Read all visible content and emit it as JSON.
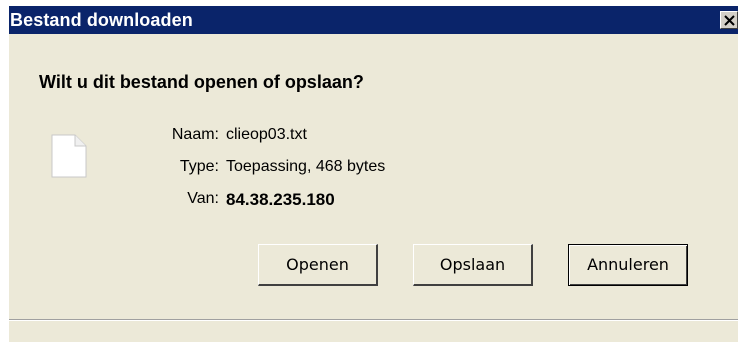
{
  "window": {
    "title": "Bestand downloaden"
  },
  "dialog": {
    "question": "Wilt u dit bestand openen of opslaan?",
    "file_icon": "text-file-icon",
    "rows": [
      {
        "label": "Naam:",
        "value": "clieop03.txt"
      },
      {
        "label": "Type:",
        "value": "Toepassing, 468 bytes"
      },
      {
        "label": "Van:",
        "value": "84.38.235.180"
      }
    ]
  },
  "buttons": {
    "open_label": "Openen",
    "save_label": "Opslaan",
    "cancel_label": "Annuleren"
  },
  "colors": {
    "titlebar": "#0a246a",
    "dialog_bg": "#ece9d8"
  }
}
